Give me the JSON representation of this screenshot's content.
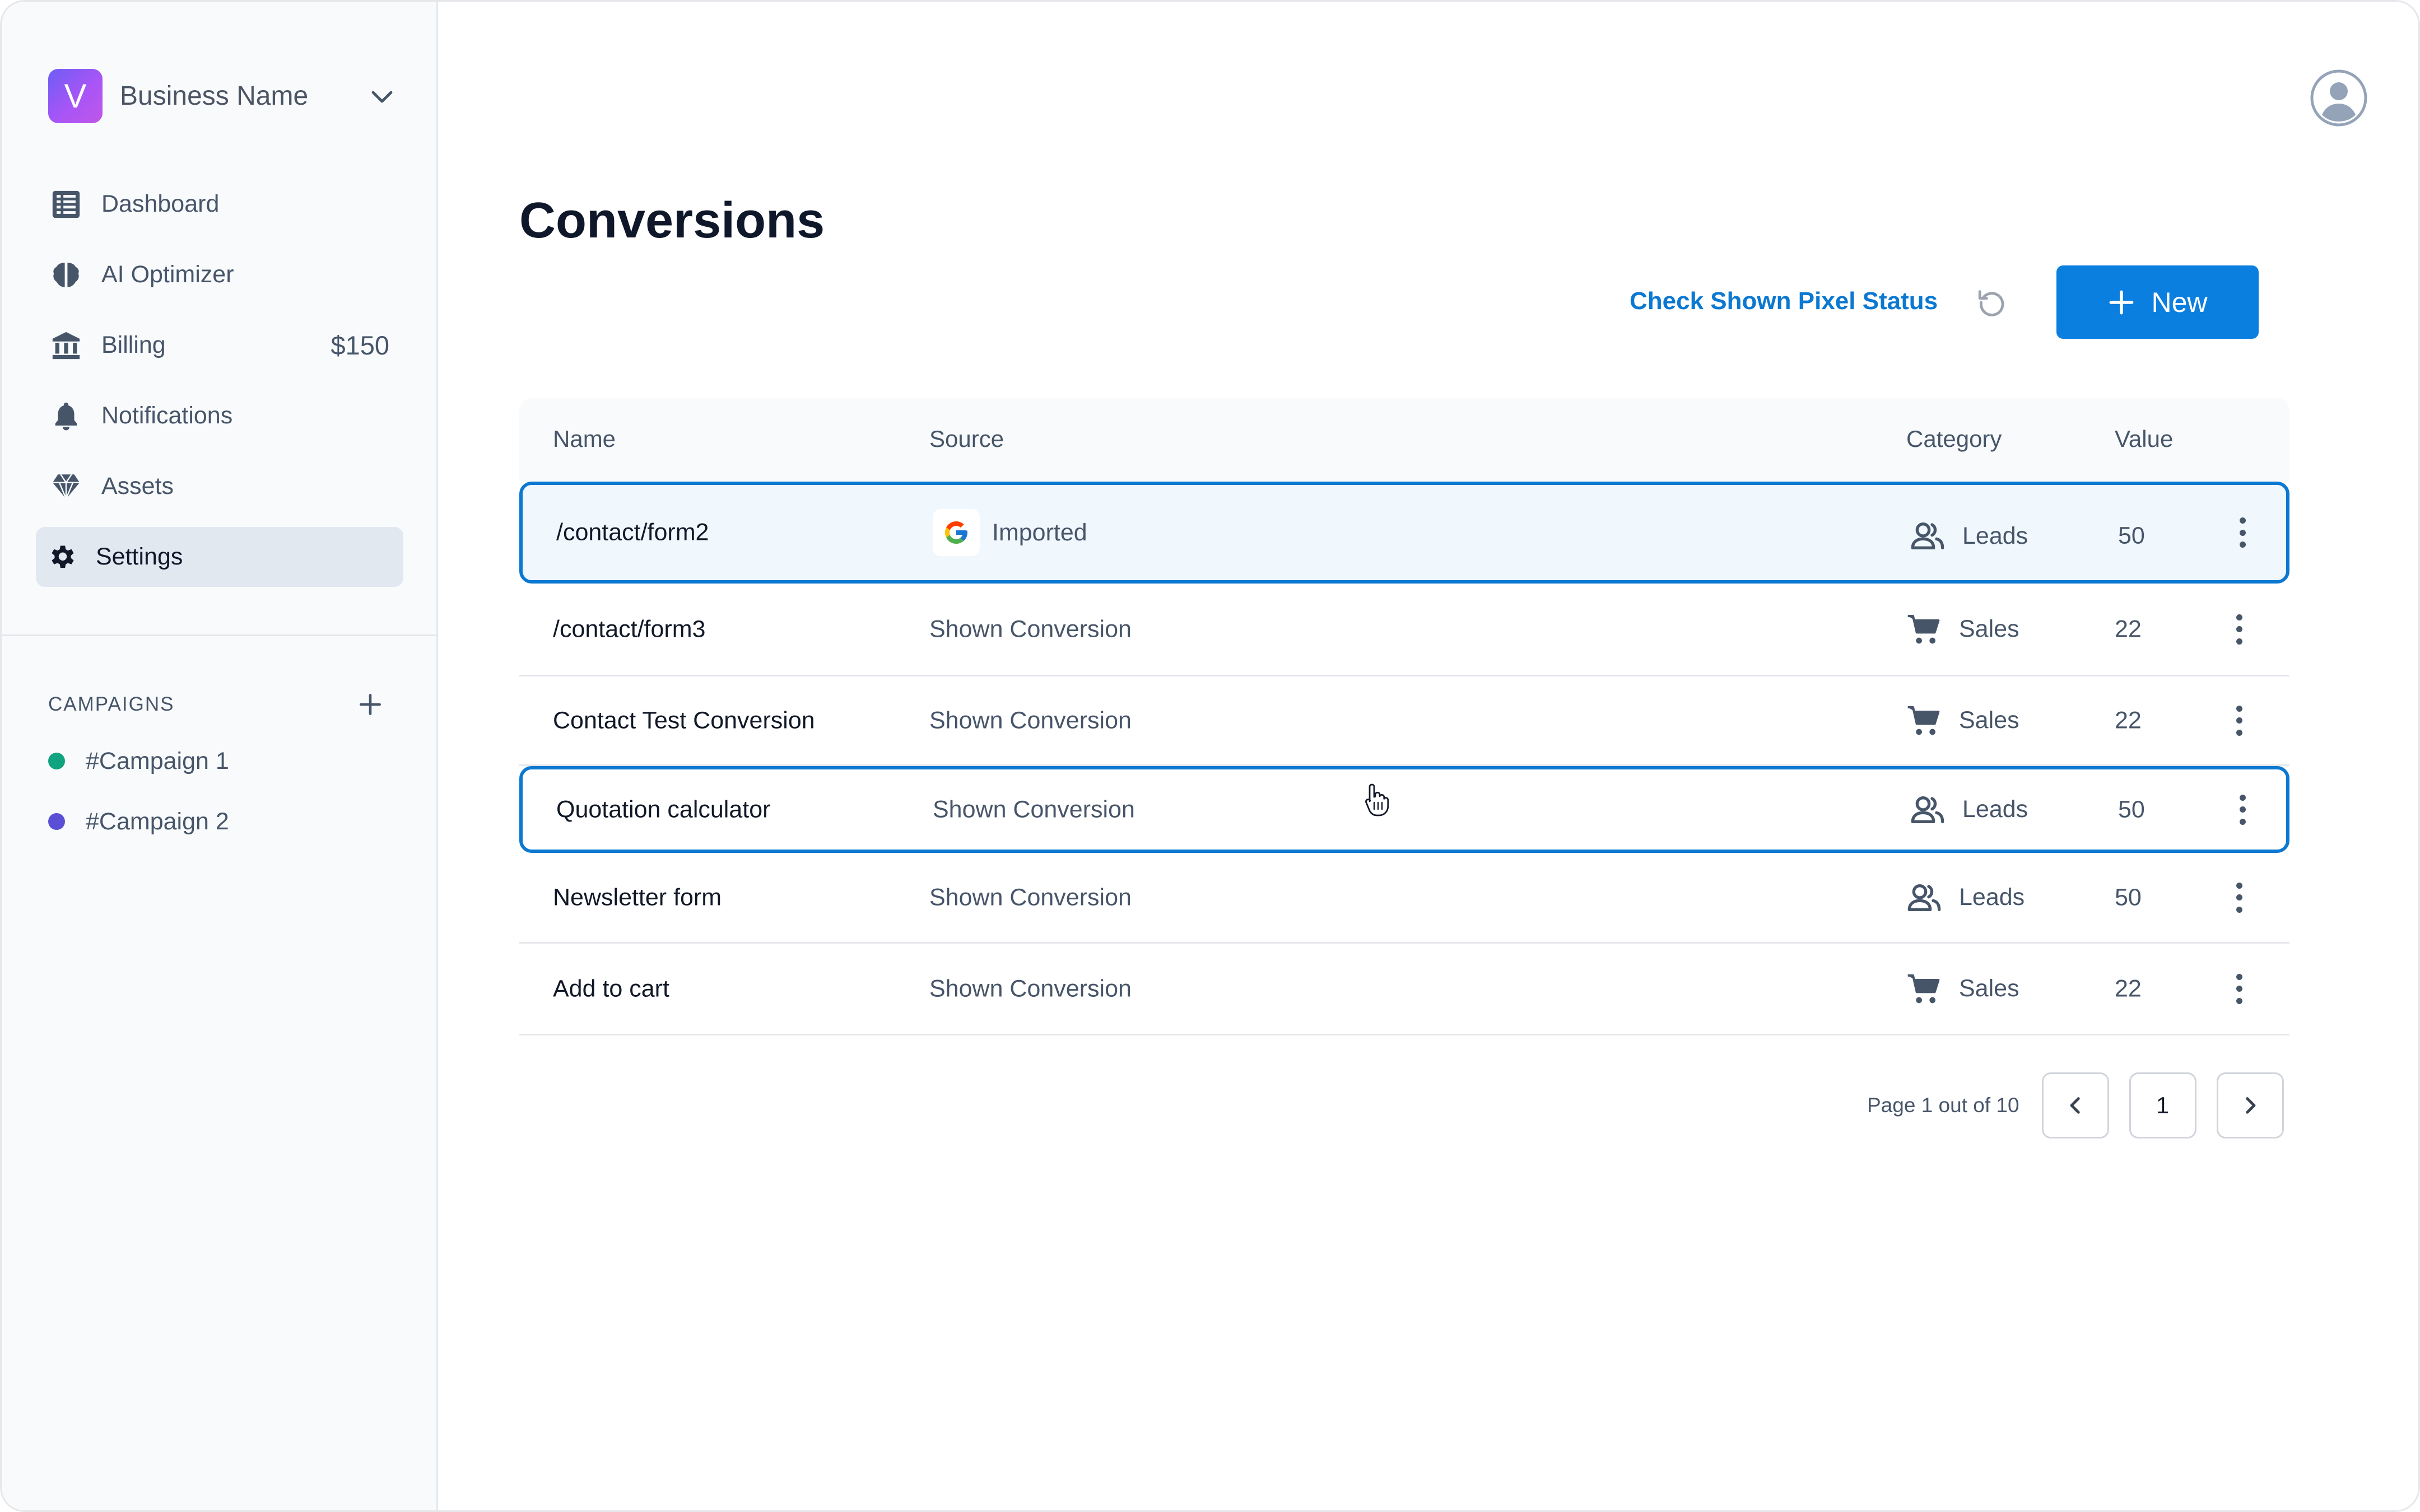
{
  "sidebar": {
    "business_name": "Business Name",
    "logo_letter": "V",
    "nav": [
      {
        "label": "Dashboard",
        "icon": "dashboard-icon"
      },
      {
        "label": "AI Optimizer",
        "icon": "brain-icon"
      },
      {
        "label": "Billing",
        "icon": "bank-icon",
        "amount": "$150"
      },
      {
        "label": "Notifications",
        "icon": "bell-icon"
      },
      {
        "label": "Assets",
        "icon": "diamond-icon"
      },
      {
        "label": "Settings",
        "icon": "gear-icon",
        "active": true
      }
    ],
    "campaigns_heading": "CAMPAIGNS",
    "campaigns": [
      {
        "label": "#Campaign 1",
        "color": "#10a37f"
      },
      {
        "label": "#Campaign 2",
        "color": "#5b4fd6"
      }
    ]
  },
  "main": {
    "title": "Conversions",
    "check_status_label": "Check Shown Pixel Status",
    "new_button_label": "New",
    "table": {
      "headers": {
        "name": "Name",
        "source": "Source",
        "category": "Category",
        "value": "Value"
      },
      "rows": [
        {
          "name": "/contact/form2",
          "source": "Imported",
          "category": "Leads",
          "value": "50"
        },
        {
          "name": "/contact/form3",
          "source": "Shown Conversion",
          "category": "Sales",
          "value": "22"
        },
        {
          "name": "Contact Test Conversion",
          "source": "Shown Conversion",
          "category": "Sales",
          "value": "22"
        },
        {
          "name": "Quotation calculator",
          "source": "Shown Conversion",
          "category": "Leads",
          "value": "50"
        },
        {
          "name": "Newsletter form",
          "source": "Shown Conversion",
          "category": "Leads",
          "value": "50"
        },
        {
          "name": "Add to cart",
          "source": "Shown Conversion",
          "category": "Sales",
          "value": "22"
        }
      ]
    },
    "pagination": {
      "text": "Page 1 out of 10",
      "current": "1"
    }
  },
  "colors": {
    "accent": "#0b7fe0",
    "link": "#0b78d1"
  }
}
